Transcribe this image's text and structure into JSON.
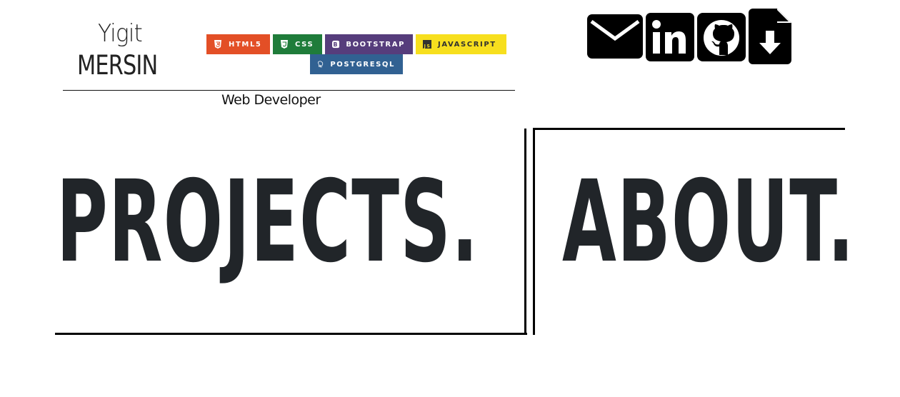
{
  "header": {
    "name_first": "Yigit",
    "name_last": "MERSIN",
    "subtitle": "Web Developer"
  },
  "tech_badges": [
    {
      "label": "HTML5",
      "color": "#e34f26"
    },
    {
      "label": "CSS",
      "color": "#1f7c3a"
    },
    {
      "label": "BOOTSTRAP",
      "color": "#563d7c"
    },
    {
      "label": "JAVASCRIPT",
      "color": "#f7df1e"
    },
    {
      "label": "POSTGRESQL",
      "color": "#316192"
    }
  ],
  "contact_icons": [
    "mail-icon",
    "linkedin-icon",
    "github-icon",
    "download-file-icon"
  ],
  "sections": {
    "projects": "PROJECTS.",
    "about": "ABOUT."
  }
}
